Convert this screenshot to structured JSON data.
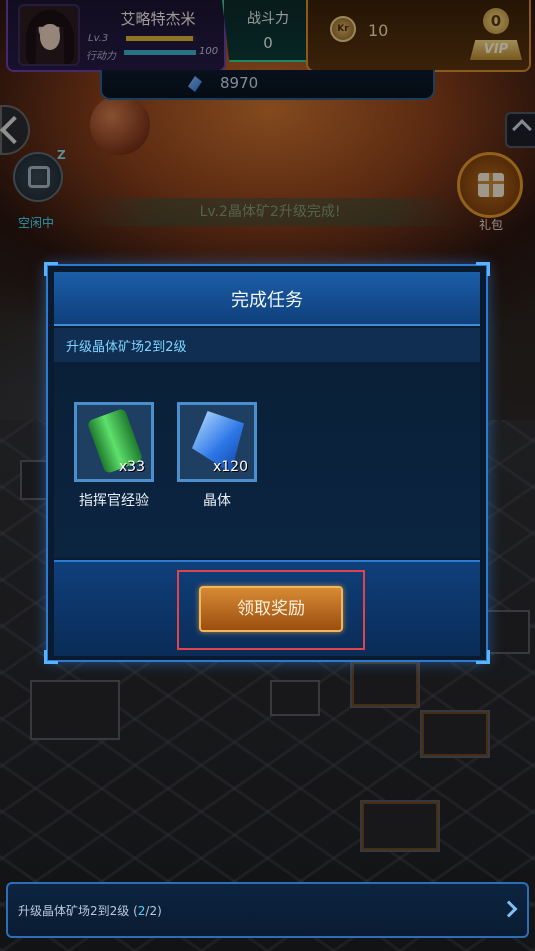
{
  "player": {
    "name": "艾略特杰米",
    "level_label": "Lv.3",
    "level_progress": 0.95,
    "energy_label": "行动力",
    "energy_value": "100",
    "energy_progress": 1.0
  },
  "power": {
    "label": "战斗力",
    "value": "0"
  },
  "currency": {
    "gold_icon_text": "Kr",
    "gold_value": "10",
    "vip_level": "0",
    "vip_label": "VIP",
    "crystal_value": "8970"
  },
  "side": {
    "idle_label": "空闲中",
    "idle_zz": "Z",
    "gift_label": "礼包"
  },
  "notice": "Lv.2晶体矿2升级完成!",
  "modal": {
    "title": "完成任务",
    "task_name": "升级晶体矿场2到2级",
    "rewards": [
      {
        "icon": "energy-can-icon",
        "count": "x33",
        "label": "指挥官经验"
      },
      {
        "icon": "crystal-icon",
        "count": "x120",
        "label": "晶体"
      }
    ],
    "claim_label": "领取奖励"
  },
  "quest_bar": {
    "text": "升级晶体矿场2到2级",
    "progress_open": " (",
    "progress_current": "2",
    "progress_rest": "/2)"
  },
  "colors": {
    "accent_blue": "#2b7bd2",
    "claim_orange": "#d78a34",
    "highlight_red": "#e0444a",
    "idle_cyan": "#43e0ff"
  }
}
